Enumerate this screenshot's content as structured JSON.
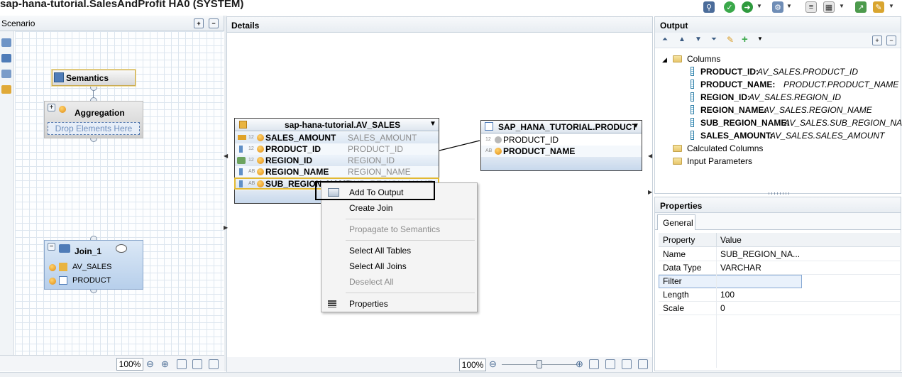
{
  "window": {
    "title": "sap-hana-tutorial.SalesAndProfit HA0 (SYSTEM)"
  },
  "scenario": {
    "header": "Scenario",
    "semantics_label": "Semantics",
    "aggregation_label": "Aggregation",
    "drop_placeholder": "Drop Elements Here",
    "join": {
      "label": "Join_1",
      "inputs": [
        "AV_SALES",
        "PRODUCT"
      ]
    },
    "zoom": "100%"
  },
  "details": {
    "header": "Details",
    "zoom": "100%",
    "av_sales": {
      "title": "sap-hana-tutorial.AV_SALES",
      "rows": [
        {
          "name": "SALES_AMOUNT",
          "source": "SALES_AMOUNT",
          "type": "12"
        },
        {
          "name": "PRODUCT_ID",
          "source": "PRODUCT_ID",
          "type": "12"
        },
        {
          "name": "REGION_ID",
          "source": "REGION_ID",
          "type": "12"
        },
        {
          "name": "REGION_NAME",
          "source": "REGION_NAME",
          "type": "AB"
        },
        {
          "name": "SUB_REGION_NAME",
          "source": "SUB_REGION_NAME",
          "type": "AB"
        }
      ]
    },
    "product": {
      "title": "SAP_HANA_TUTORIAL.PRODUCT",
      "rows": [
        {
          "name": "PRODUCT_ID",
          "type": "12"
        },
        {
          "name": "PRODUCT_NAME",
          "type": "AB"
        }
      ]
    },
    "context_menu": {
      "items": [
        {
          "label": "Add To Output",
          "enabled": true
        },
        {
          "label": "Create Join",
          "enabled": true
        },
        {
          "label": "Propagate to Semantics",
          "enabled": false
        },
        {
          "label": "Select All Tables",
          "enabled": true
        },
        {
          "label": "Select All Joins",
          "enabled": true
        },
        {
          "label": "Deselect All",
          "enabled": false
        },
        {
          "label": "Properties",
          "enabled": true
        }
      ]
    }
  },
  "output": {
    "header": "Output",
    "columns_folder": "Columns",
    "columns": [
      {
        "name": "PRODUCT_ID:",
        "source": "AV_SALES.PRODUCT_ID"
      },
      {
        "name": "PRODUCT_NAME:",
        "source": "PRODUCT.PRODUCT_NAME"
      },
      {
        "name": "REGION_ID:",
        "source": "AV_SALES.REGION_ID"
      },
      {
        "name": "REGION_NAME:",
        "source": "AV_SALES.REGION_NAME"
      },
      {
        "name": "SUB_REGION_NAME:",
        "source": "AV_SALES.SUB_REGION_NAME"
      },
      {
        "name": "SALES_AMOUNT:",
        "source": "AV_SALES.SALES_AMOUNT"
      }
    ],
    "calculated_columns": "Calculated Columns",
    "input_parameters": "Input Parameters"
  },
  "properties": {
    "header": "Properties",
    "tab": "General",
    "col_property": "Property",
    "col_value": "Value",
    "rows": [
      {
        "property": "Name",
        "value": "SUB_REGION_NA..."
      },
      {
        "property": "Data Type",
        "value": "VARCHAR"
      },
      {
        "property": "Filter",
        "value": ""
      },
      {
        "property": "Length",
        "value": "100"
      },
      {
        "property": "Scale",
        "value": "0"
      }
    ]
  },
  "colors": {
    "selection_border": "#e2b933",
    "menu_highlight_border": "#000000",
    "panel_border": "#c7d1db"
  }
}
